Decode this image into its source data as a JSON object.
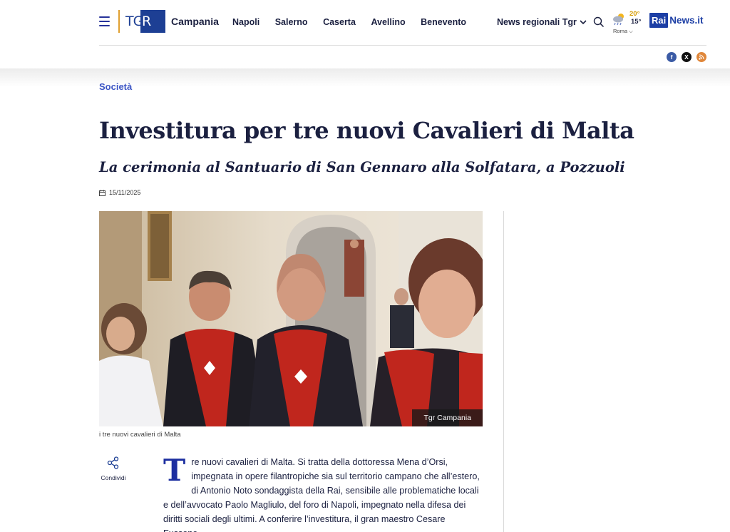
{
  "header": {
    "logo_text_left": "TG",
    "logo_text_right": "R",
    "region": "Campania",
    "nav": [
      "Napoli",
      "Salerno",
      "Caserta",
      "Avellino",
      "Benevento"
    ],
    "news_regionali": "News regionali Tgr",
    "weather": {
      "max": "20°",
      "min": "15°",
      "city": "Roma"
    },
    "brand_rai": "Rai",
    "brand_news": "News.it",
    "social": {
      "facebook": "f",
      "x": "X",
      "rss": "rss"
    }
  },
  "article": {
    "category": "Società",
    "title": "Investitura per tre nuovi Cavalieri di Malta",
    "subtitle": "La cerimonia al Santuario di San Gennaro alla Solfatara, a Pozzuoli",
    "date": "15/11/2025",
    "photo_credit": "Tgr Campania",
    "caption": "i tre nuovi cavalieri di Malta",
    "share_label": "Condividi",
    "dropcap": "T",
    "body": "re nuovi cavalieri di Malta. Si tratta della dottoressa Mena d’Orsi, impegnata in opere filantropiche sia sul territorio campano che all’estero, di Antonio Noto sondaggista della Rai, sensibile alle problematiche locali e dell’avvocato Paolo Magliulo, del foro di Napoli, impegnato nella difesa dei diritti sociali degli ultimi. A conferire l’investitura, il gran maestro Cesare Fussone."
  },
  "colors": {
    "brand": "#1d3f94",
    "accent": "#3d56c5",
    "dropcap": "#1d2fa0"
  }
}
